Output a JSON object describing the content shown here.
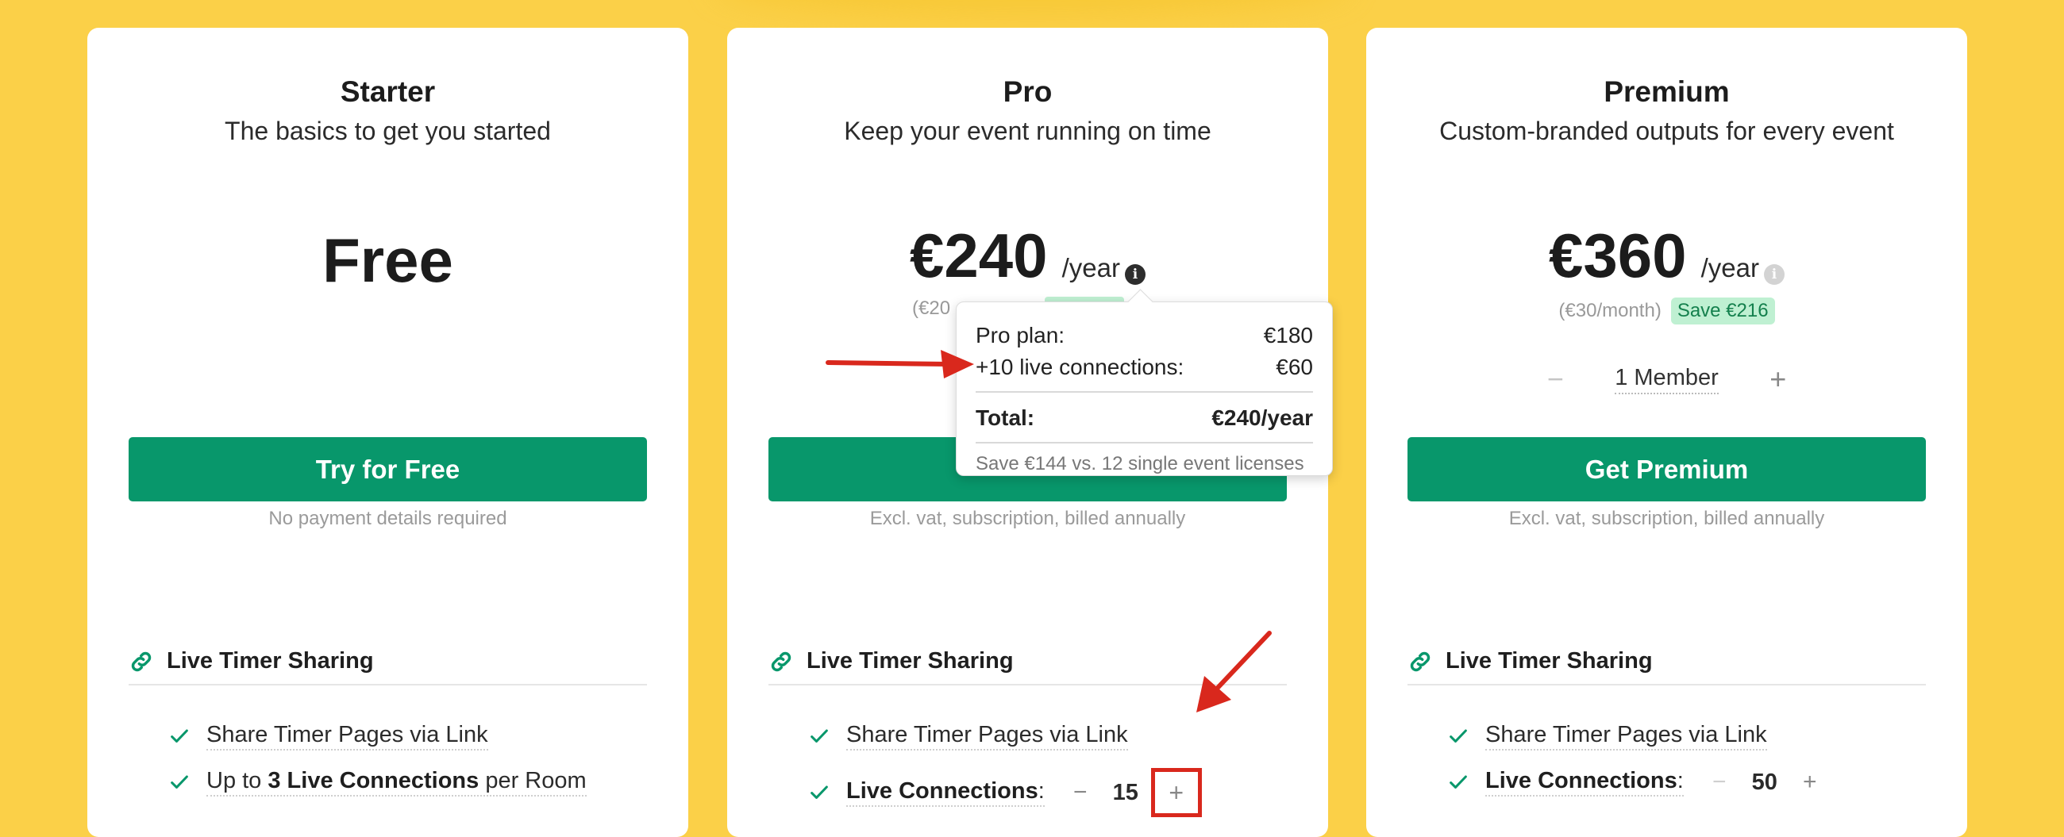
{
  "plans": {
    "starter": {
      "name": "Starter",
      "subtitle": "The basics to get you started",
      "price": "Free",
      "cta_label": "Try for Free",
      "cta_note": "No payment details required",
      "feature_heading": "Live Timer Sharing",
      "feature_1": "Share Timer Pages via Link",
      "feature_2_prefix": "Up to ",
      "feature_2_bold": "3 Live Connections",
      "feature_2_suffix": " per Room"
    },
    "pro": {
      "name": "Pro",
      "subtitle": "Keep your event running on time",
      "price": "€240",
      "price_unit": "/year",
      "monthly_partial": "(€20",
      "cta_note": "Excl. vat, subscription, billed annually",
      "feature_heading": "Live Timer Sharing",
      "feature_1": "Share Timer Pages via Link",
      "connections_label": "Live Connections",
      "connections_colon": ":",
      "connections_value": "15",
      "minus_glyph": "−",
      "plus_glyph": "+"
    },
    "premium": {
      "name": "Premium",
      "subtitle": "Custom-branded outputs for every event",
      "price": "€360",
      "price_unit": "/year",
      "monthly": "(€30/month)",
      "save_badge": "Save €216",
      "member_count": "1 Member",
      "minus_glyph": "−",
      "plus_glyph": "+",
      "cta_label": "Get Premium",
      "cta_note": "Excl. vat, subscription, billed annually",
      "feature_heading": "Live Timer Sharing",
      "feature_1": "Share Timer Pages via Link",
      "connections_label": "Live Connections",
      "connections_colon": ":",
      "connections_value": "50"
    }
  },
  "tooltip": {
    "row1_label": "Pro plan:",
    "row1_value": "€180",
    "row2_label": "+10 live connections:",
    "row2_value": "€60",
    "total_label": "Total:",
    "total_value": "€240/year",
    "save_note": "Save €144 vs. 12 single event licenses"
  },
  "icons": {
    "info": "i",
    "check": "check-icon",
    "link": "link-icon"
  },
  "colors": {
    "background": "#fbd048",
    "cta_green": "#08976b",
    "check_green": "#08976b",
    "annotation_red": "#d9281d",
    "save_badge_bg": "#bff0d2"
  }
}
